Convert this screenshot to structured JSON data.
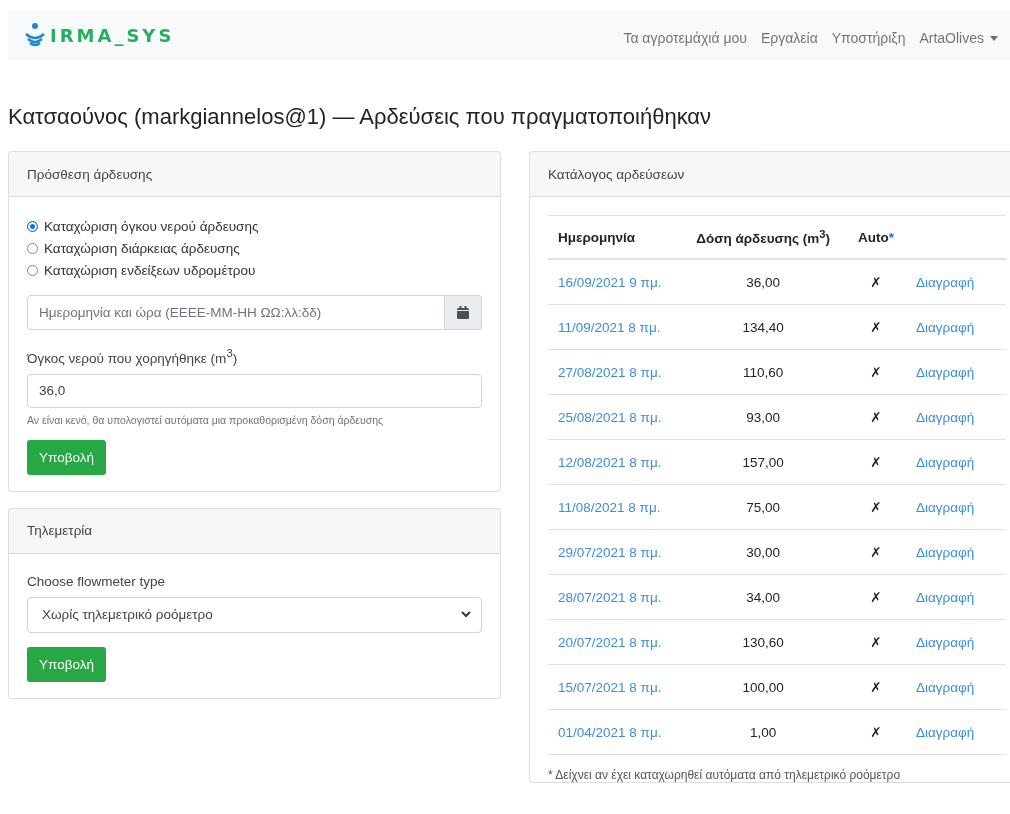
{
  "navbar": {
    "brand": "IRMA_SYS",
    "links": [
      {
        "label": "Τα αγροτεμάχιά μου",
        "kind": "link"
      },
      {
        "label": "Εργαλεία",
        "kind": "link"
      },
      {
        "label": "Υποστήριξη",
        "kind": "link"
      },
      {
        "label": "ArtaOlives",
        "kind": "dropdown"
      }
    ]
  },
  "page_title": "Κατσαούνος (markgiannelos@1) — Αρδεύσεις που πραγματοποιήθηκαν",
  "add_card": {
    "title": "Πρόσθεση άρδευσης",
    "options": [
      {
        "label": "Καταχώριση όγκου νερού άρδευσης",
        "selected": true
      },
      {
        "label": "Καταχώριση διάρκειας άρδευσης",
        "selected": false
      },
      {
        "label": "Καταχώριση ενδείξεων υδρομέτρου",
        "selected": false
      }
    ],
    "datetime": {
      "placeholder": "Ημερομηνία και ώρα (ΕΕΕΕ-ΜΜ-ΗΗ ΩΩ:λλ:δδ)"
    },
    "volume": {
      "label": "Όγκος νερού που χορηγήθηκε (m$^{3}$)",
      "value": "36,0",
      "help": "Αν είναι κενό, θα υπολογιστεί αυτόματα μια προκαθορισμένη δόση άρδευσης"
    },
    "submit": "Υποβολή"
  },
  "telemetry_card": {
    "title": "Τηλεμετρία",
    "label": "Choose flowmeter type",
    "select_value": "Χωρίς τηλεμετρικό ροόμετρο",
    "submit": "Υποβολή"
  },
  "list_card": {
    "title": "Κατάλογος αρδεύσεων",
    "columns": [
      {
        "label": "Ημερομηνία"
      },
      {
        "label": "Δόση άρδευσης (m$^{3}$)"
      },
      {
        "label": "Auto",
        "note": "*"
      }
    ],
    "rows": [
      {
        "date": "16/09/2021 9 πμ.",
        "dose": "36,00",
        "auto": "✗",
        "action": "Διαγραφή"
      },
      {
        "date": "11/09/2021 8 πμ.",
        "dose": "134,40",
        "auto": "✗",
        "action": "Διαγραφή"
      },
      {
        "date": "27/08/2021 8 πμ.",
        "dose": "110,60",
        "auto": "✗",
        "action": "Διαγραφή"
      },
      {
        "date": "25/08/2021 8 πμ.",
        "dose": "93,00",
        "auto": "✗",
        "action": "Διαγραφή"
      },
      {
        "date": "12/08/2021 8 πμ.",
        "dose": "157,00",
        "auto": "✗",
        "action": "Διαγραφή"
      },
      {
        "date": "11/08/2021 8 πμ.",
        "dose": "75,00",
        "auto": "✗",
        "action": "Διαγραφή"
      },
      {
        "date": "29/07/2021 8 πμ.",
        "dose": "30,00",
        "auto": "✗",
        "action": "Διαγραφή"
      },
      {
        "date": "28/07/2021 8 πμ.",
        "dose": "34,00",
        "auto": "✗",
        "action": "Διαγραφή"
      },
      {
        "date": "20/07/2021 8 πμ.",
        "dose": "130,60",
        "auto": "✗",
        "action": "Διαγραφή"
      },
      {
        "date": "15/07/2021 8 πμ.",
        "dose": "100,00",
        "auto": "✗",
        "action": "Διαγραφή"
      },
      {
        "date": "01/04/2021 8 πμ.",
        "dose": "1,00",
        "auto": "✗",
        "action": "Διαγραφή"
      }
    ],
    "footnote": "* Δείχνει αν έχει καταχωρηθεί αυτόματα από τηλεμετρικό ροόμετρο"
  }
}
